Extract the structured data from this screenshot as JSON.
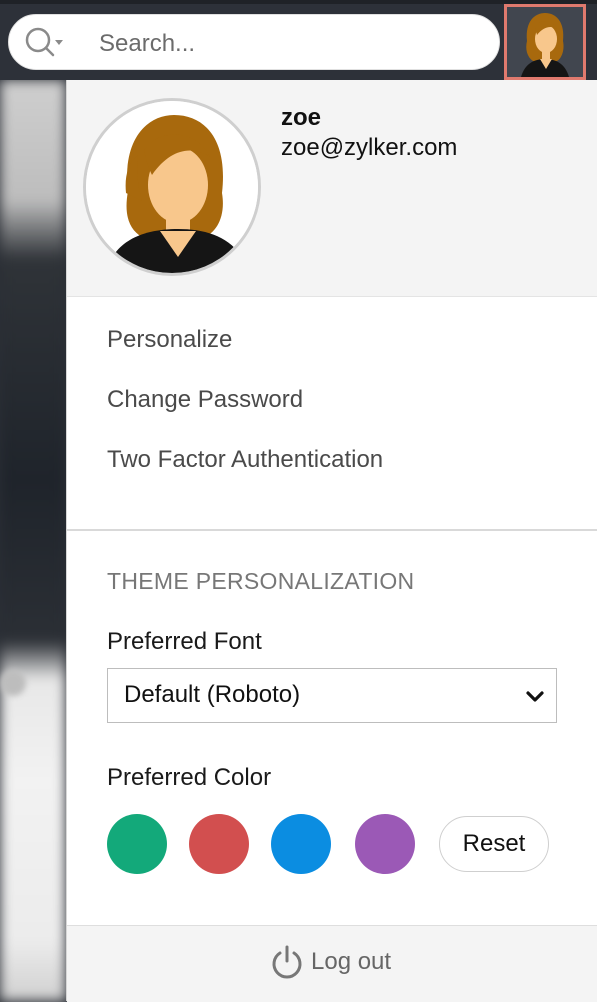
{
  "search": {
    "placeholder": "Search..."
  },
  "user": {
    "name": "zoe",
    "email": "zoe@zylker.com"
  },
  "menu": {
    "items": [
      {
        "label": "Personalize"
      },
      {
        "label": "Change Password"
      },
      {
        "label": "Two Factor Authentication"
      }
    ]
  },
  "theme": {
    "title": "THEME PERSONALIZATION",
    "font_label": "Preferred Font",
    "font_value": "Default (Roboto)",
    "color_label": "Preferred Color",
    "colors": [
      "#13a97a",
      "#d24f4f",
      "#0b8de1",
      "#9b59b6"
    ],
    "reset_label": "Reset"
  },
  "footer": {
    "logout_label": "Log out"
  },
  "icons": {
    "search": "search-icon",
    "dropdown": "caret-down-icon",
    "select": "chevron-down-icon",
    "logout": "power-icon"
  }
}
